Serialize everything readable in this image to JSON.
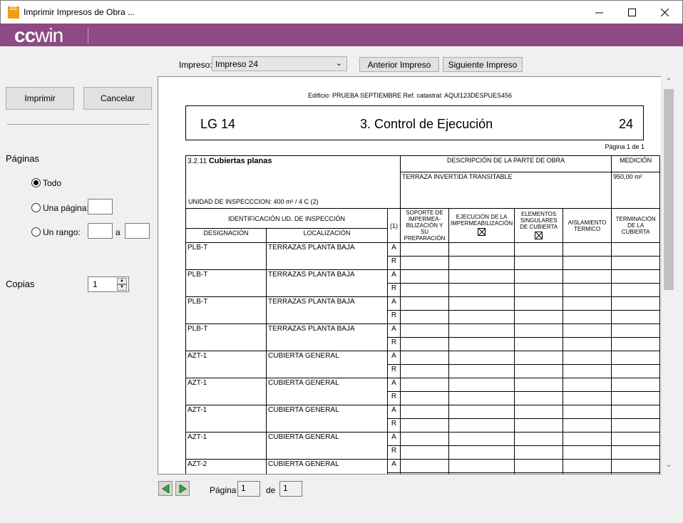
{
  "window": {
    "title": "Imprimir Impresos de Obra ...",
    "icon_text": "CC"
  },
  "brand": {
    "logo_bold": "cc",
    "logo_light": "win"
  },
  "toolbar": {
    "impreso_label": "Impreso:",
    "impreso_value": "Impreso 24",
    "prev_label": "Anterior Impreso",
    "next_label": "Siguiente Impreso"
  },
  "left": {
    "print_label": "Imprimir",
    "cancel_label": "Cancelar",
    "pages_heading": "Páginas",
    "opt_all": "Todo",
    "opt_one": "Una página:",
    "opt_range": "Un rango:",
    "range_sep": "a",
    "copies_label": "Copias",
    "copies_value": "1"
  },
  "doc": {
    "header_line": "Edificio: PRUEBA SEPTIEMBRE  Ref. catastral: AQUI123DESPUES456",
    "lg_code": "LG 14",
    "lg_title": "3. Control de Ejecución",
    "lg_number": "24",
    "page_of": "Página 1 de 1",
    "section_num": "3.2.11",
    "section_title": "Cubiertas planas",
    "unit_text": "UNIDAD DE INSPECCCION: 400 m² / 4 C (2)",
    "desc_header": "DESCRIPCIÓN DE LA PARTE DE OBRA",
    "desc_value": "TERRAZA INVERTIDA TRANSITABLE",
    "med_header": "MEDICIÓN",
    "med_value": "950,00 m²",
    "ident_header": "IDENTIFICACIÓN UD. DE INSPECCIÓN",
    "col_designacion": "DESIGNACIÓN",
    "col_localizacion": "LOCALIZACIÓN",
    "col_one": "(1)",
    "checks": [
      "SOPORTE DE IMPERMEA-BILIZACIÓN Y SU PREPARACIÓN",
      "EJECUCIÓN DE LA IMPERMEABILIZACIÓN",
      "ELEMENTOS SINGULARES DE CUBIERTA",
      "AISLAMIENTO TERMICO",
      "TERMINACIÓN DE LA CUBIERTA"
    ],
    "ar": [
      "A",
      "R"
    ],
    "rows": [
      {
        "des": "PLB-T",
        "loc": "TERRAZAS PLANTA BAJA"
      },
      {
        "des": "PLB-T",
        "loc": "TERRAZAS PLANTA BAJA"
      },
      {
        "des": "PLB-T",
        "loc": "TERRAZAS PLANTA BAJA"
      },
      {
        "des": "PLB-T",
        "loc": "TERRAZAS PLANTA BAJA"
      },
      {
        "des": "AZT-1",
        "loc": "CUBIERTA GENERAL"
      },
      {
        "des": "AZT-1",
        "loc": "CUBIERTA GENERAL"
      },
      {
        "des": "AZT-1",
        "loc": "CUBIERTA GENERAL"
      },
      {
        "des": "AZT-1",
        "loc": "CUBIERTA GENERAL"
      },
      {
        "des": "AZT-2",
        "loc": "CUBIERTA GENERAL"
      }
    ]
  },
  "footer": {
    "page_label": "Página",
    "page_value": "1",
    "of_label": "de",
    "total_value": "1"
  }
}
